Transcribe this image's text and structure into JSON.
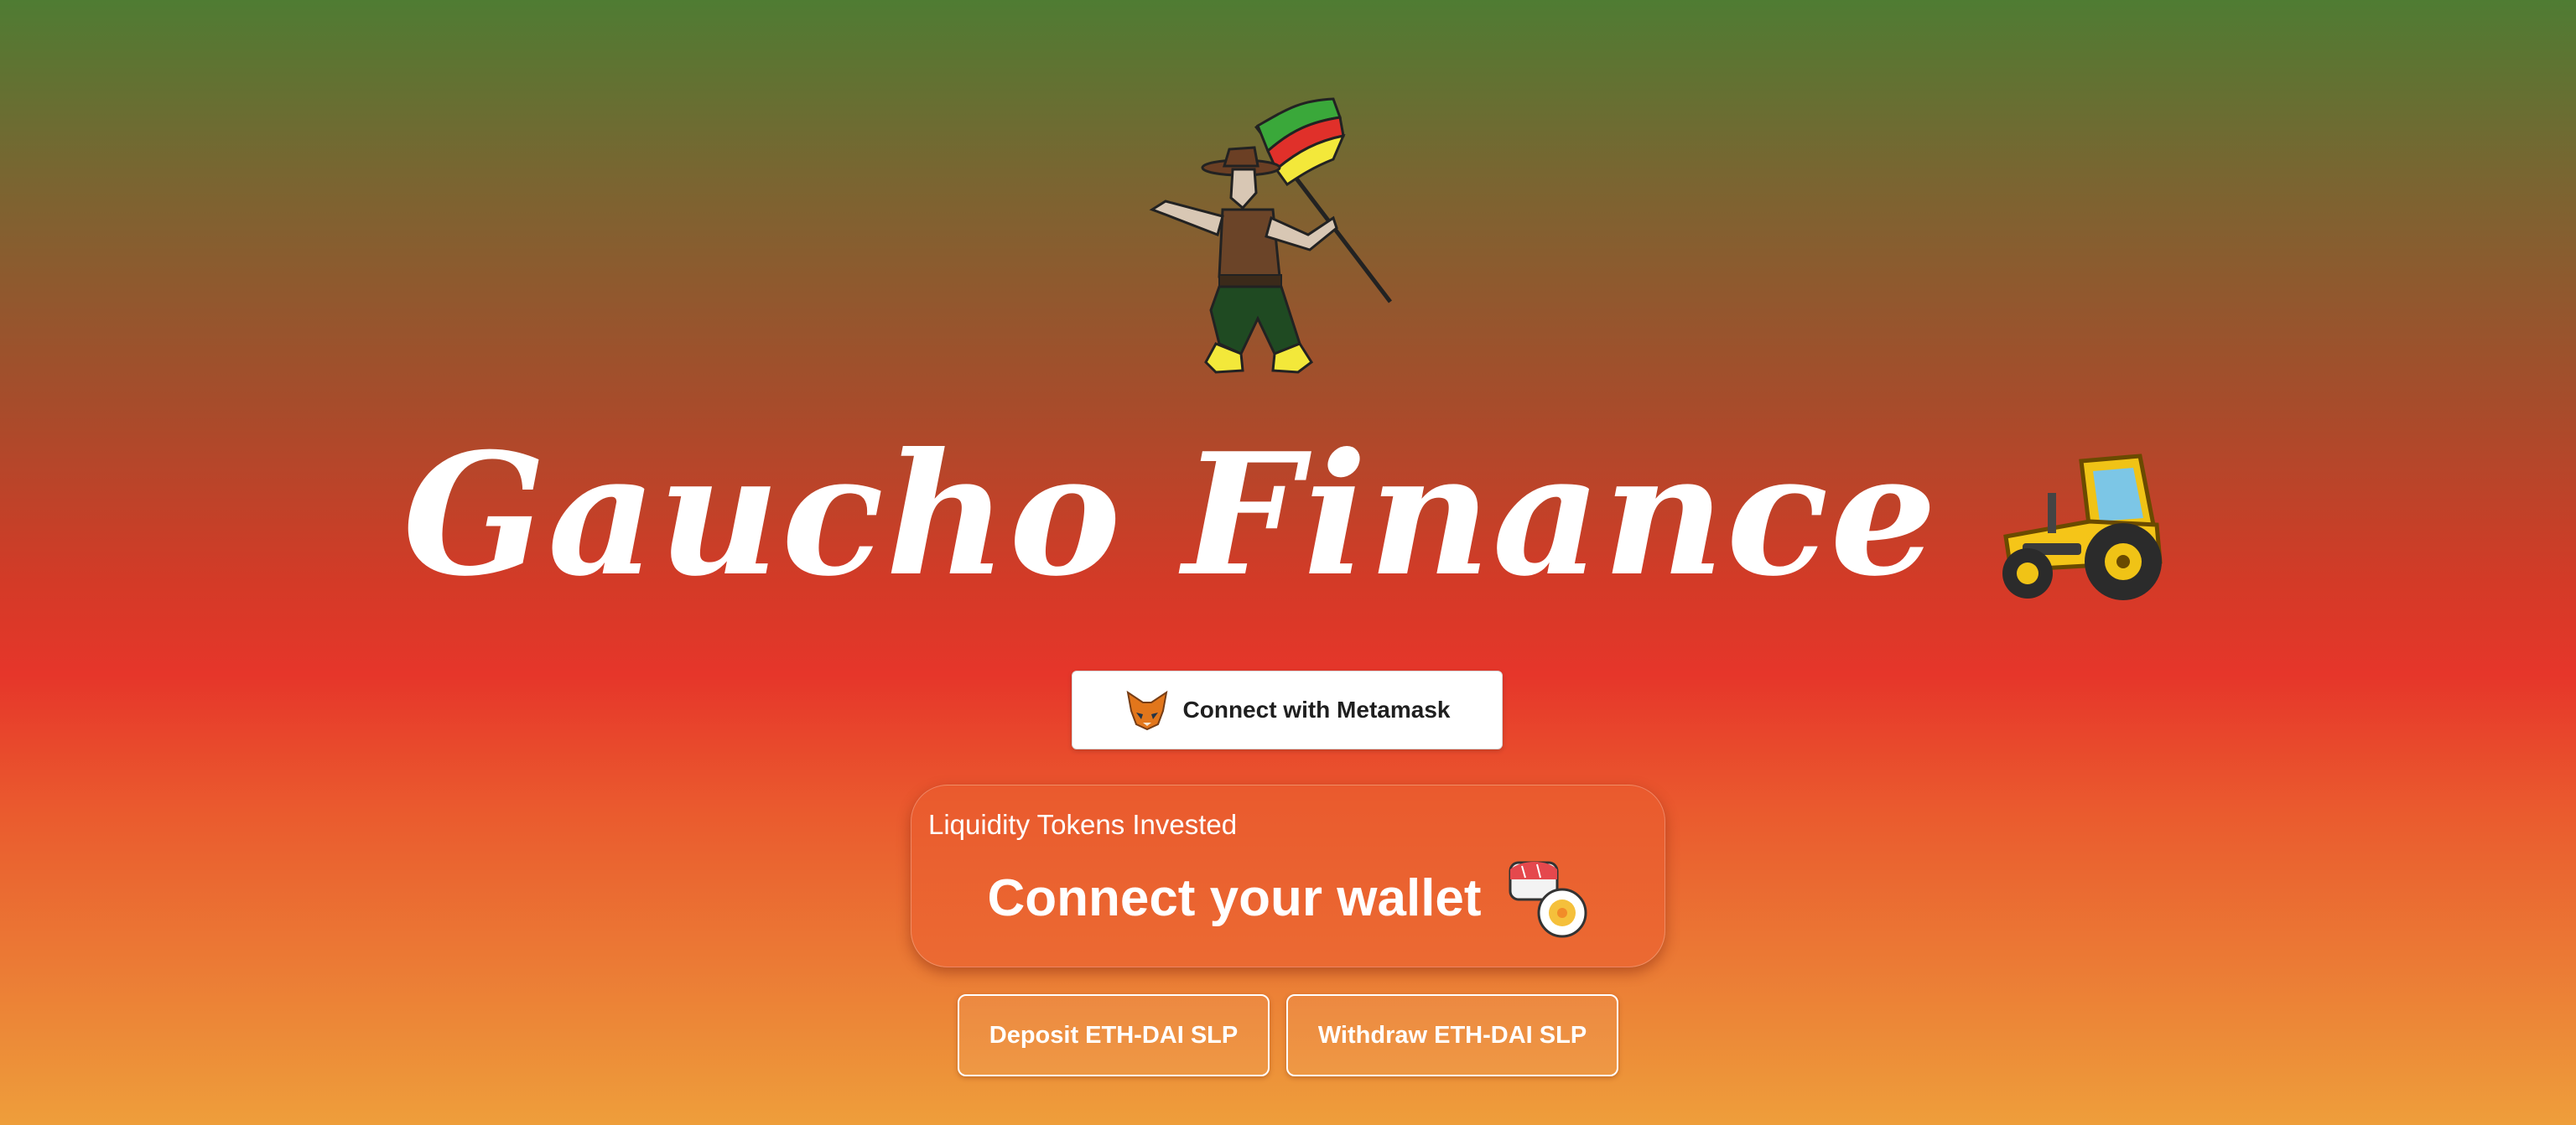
{
  "hero": {
    "title": "Gaucho Finance",
    "mascot_icon": "gaucho-mascot-icon",
    "tractor_icon": "tractor-icon"
  },
  "wallet": {
    "connect_label": "Connect with Metamask",
    "connect_icon": "metamask-fox-icon"
  },
  "liquidity_card": {
    "label": "Liquidity Tokens Invested",
    "value": "Connect your wallet",
    "icon": "sushi-icon"
  },
  "actions": {
    "deposit_label": "Deposit ETH-DAI SLP",
    "withdraw_label": "Withdraw ETH-DAI SLP"
  },
  "colors": {
    "gradient_top": "#4f7c33",
    "gradient_mid": "#e6362a",
    "gradient_bottom": "#ee9e3b",
    "text": "#ffffff"
  }
}
